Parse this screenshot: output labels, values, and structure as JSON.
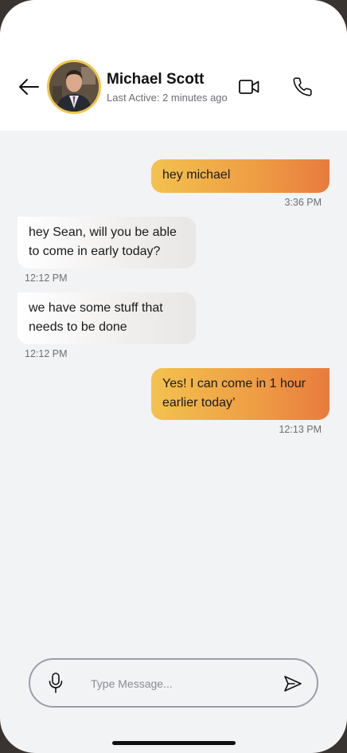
{
  "contact": {
    "name": "Michael Scott",
    "last_active": "Last Active: 2 minutes ago"
  },
  "messages": [
    {
      "direction": "outgoing",
      "text": "hey michael",
      "time": "3:36 PM"
    },
    {
      "direction": "incoming",
      "text": "hey Sean, will you be able to come in early today?",
      "time": "12:12 PM"
    },
    {
      "direction": "incoming",
      "text": "we have some stuff that needs to be done",
      "time": "12:12 PM"
    },
    {
      "direction": "outgoing",
      "text": "Yes! I can come in 1 hour earlier today’",
      "time": "12:13 PM"
    }
  ],
  "composer": {
    "placeholder": "Type Message...",
    "value": ""
  },
  "icons": {
    "back": "arrow-left-icon",
    "video": "video-camera-icon",
    "call": "phone-icon",
    "mic": "microphone-icon",
    "send": "send-icon"
  },
  "colors": {
    "accent_start": "#f3c24e",
    "accent_end": "#e87b3e",
    "avatar_ring": "#f0c44a",
    "chat_background": "#f2f3f5"
  }
}
